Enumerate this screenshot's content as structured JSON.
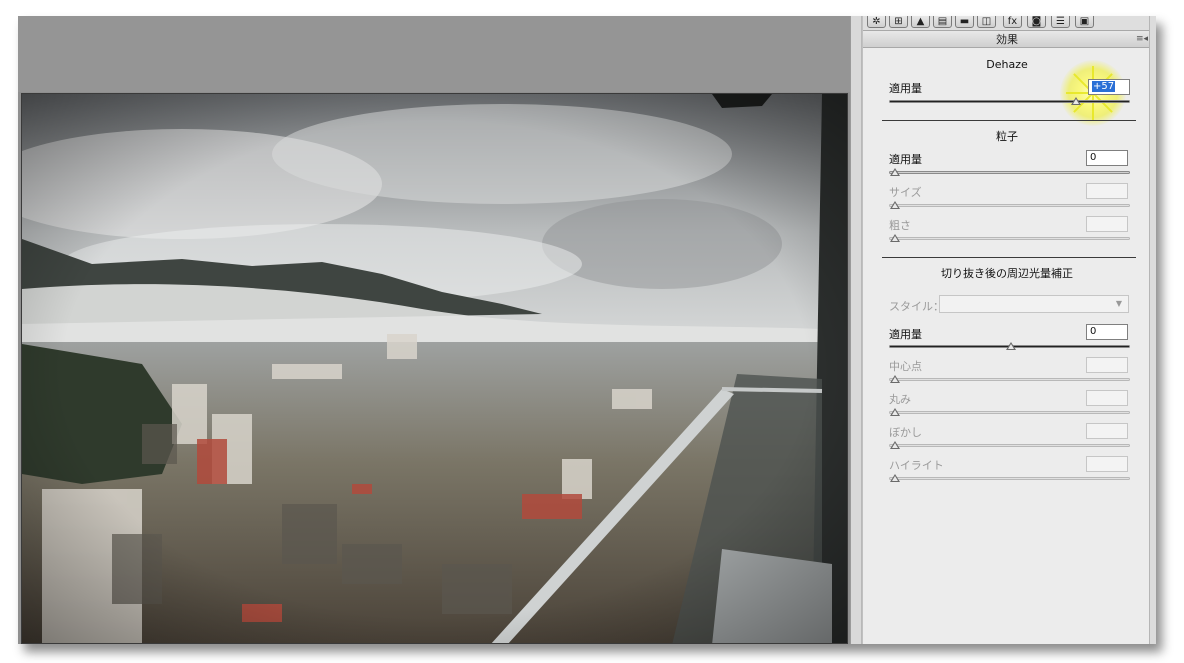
{
  "panel": {
    "header": "効果",
    "tab_icons": [
      "aperture-icon",
      "histogram-icon",
      "mountain-icon",
      "split-tone-icon",
      "bar-icon",
      "lens-icon",
      "fx-icon",
      "camera-icon",
      "preset-icon",
      "snapshot-icon"
    ],
    "dehaze": {
      "title": "Dehaze",
      "amount_label": "適用量",
      "amount_value": "+57",
      "amount_level": 0.785
    },
    "grain": {
      "title": "粒子",
      "amount_label": "適用量",
      "amount_value": "0",
      "amount_level": 0.0,
      "size_label": "サイズ",
      "size_value": "",
      "size_level": 0.0,
      "roughness_label": "粗さ",
      "roughness_value": "",
      "roughness_level": 0.0
    },
    "vignette": {
      "title": "切り抜き後の周辺光量補正",
      "style_label": "スタイル：",
      "style_value": "",
      "amount_label": "適用量",
      "amount_value": "0",
      "amount_level": 0.5,
      "midpoint_label": "中心点",
      "midpoint_value": "",
      "midpoint_level": 0.0,
      "roundness_label": "丸み",
      "roundness_value": "",
      "roundness_level": 0.0,
      "feather_label": "ぼかし",
      "feather_value": "",
      "feather_level": 0.0,
      "highlights_label": "ハイライト",
      "highlights_value": "",
      "highlights_level": 0.0
    }
  },
  "colors": {
    "accent_glow": "#f4f35a",
    "selection": "#2a6fd6",
    "panel_bg": "#ececec"
  }
}
